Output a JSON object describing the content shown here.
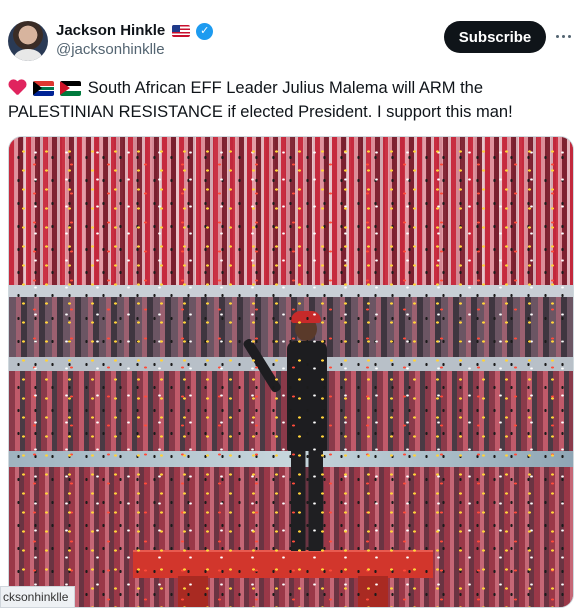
{
  "author": {
    "display_name": "Jackson Hinkle",
    "handle": "@jacksonhinklle"
  },
  "actions": {
    "subscribe_label": "Subscribe"
  },
  "tweet": {
    "text": "South African EFF Leader Julius Malema will ARM the PALESTINIAN RESISTANCE if elected President. I support this man!"
  },
  "media": {
    "watermark": "cksonhinklle"
  },
  "colors": {
    "verified_badge": "#1d9bf0",
    "subscribe_bg": "#0f1419",
    "platform": "#d2362c"
  }
}
